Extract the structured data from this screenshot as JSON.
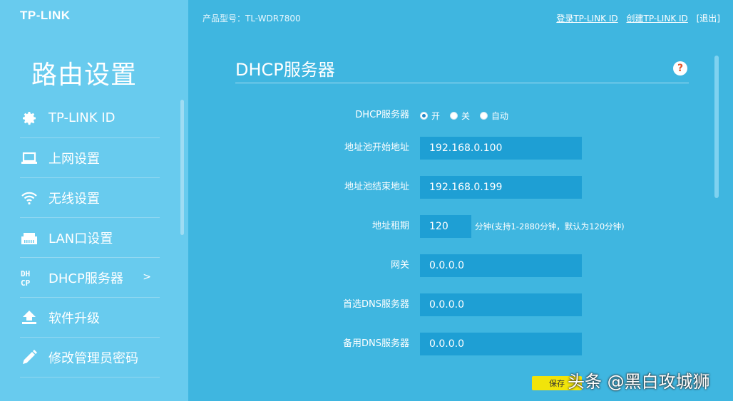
{
  "brand": {
    "logo": "TP-LINK"
  },
  "header": {
    "model": "产品型号：TL-WDR7800",
    "links": {
      "login": "登录TP-LINK ID",
      "create": "创建TP-LINK ID",
      "logout": "[退出]"
    }
  },
  "sidebar": {
    "title": "路由设置",
    "items": [
      {
        "label": "TP-LINK ID",
        "icon": "gear-icon"
      },
      {
        "label": "上网设置",
        "icon": "laptop-icon"
      },
      {
        "label": "无线设置",
        "icon": "wifi-icon"
      },
      {
        "label": "LAN口设置",
        "icon": "lan-port-icon"
      },
      {
        "label": "DHCP服务器",
        "icon": "dhcp-icon",
        "active": true,
        "arrow": ">"
      },
      {
        "label": "软件升级",
        "icon": "upload-icon"
      },
      {
        "label": "修改管理员密码",
        "icon": "pencil-icon"
      }
    ]
  },
  "main": {
    "title": "DHCP服务器",
    "help": "?",
    "dhcp": {
      "label": "DHCP服务器",
      "options": [
        "开",
        "关",
        "自动"
      ],
      "selected": "开"
    },
    "pool_start": {
      "label": "地址池开始地址",
      "value": "192.168.0.100"
    },
    "pool_end": {
      "label": "地址池结束地址",
      "value": "192.168.0.199"
    },
    "lease": {
      "label": "地址租期",
      "value": "120",
      "hint": "分钟(支持1-2880分钟，默认为120分钟)"
    },
    "gateway": {
      "label": "网关",
      "value": "0.0.0.0"
    },
    "dns_primary": {
      "label": "首选DNS服务器",
      "value": "0.0.0.0"
    },
    "dns_secondary": {
      "label": "备用DNS服务器",
      "value": "0.0.0.0"
    },
    "save_label": "保存"
  },
  "watermark": "头条 @黑白攻城狮",
  "colors": {
    "sidebar": "#68cbee",
    "main": "#3fb6e0",
    "field": "#1e9fd4",
    "save": "#f1e40a"
  }
}
